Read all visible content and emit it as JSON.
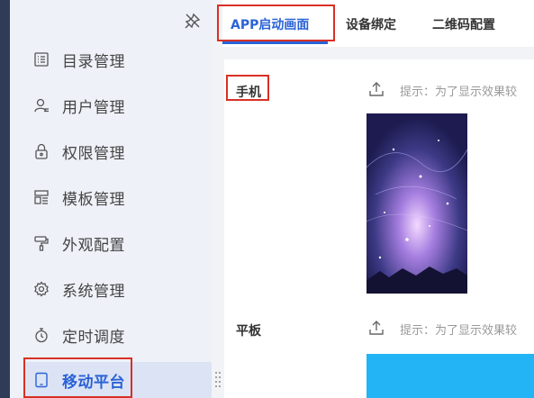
{
  "sidebar": {
    "pin_icon": "pin-icon",
    "items": [
      {
        "label": "目录管理",
        "icon": "catalog-icon"
      },
      {
        "label": "用户管理",
        "icon": "user-icon"
      },
      {
        "label": "权限管理",
        "icon": "lock-icon"
      },
      {
        "label": "模板管理",
        "icon": "template-icon"
      },
      {
        "label": "外观配置",
        "icon": "paint-roller-icon"
      },
      {
        "label": "系统管理",
        "icon": "gear-icon"
      },
      {
        "label": "定时调度",
        "icon": "stopwatch-icon"
      },
      {
        "label": "移动平台",
        "icon": "tablet-icon",
        "active": true
      }
    ]
  },
  "tabs": [
    {
      "label": "APP启动画面",
      "active": true
    },
    {
      "label": "设备绑定"
    },
    {
      "label": "二维码配置"
    }
  ],
  "content": {
    "phone": {
      "label": "手机",
      "hint": "提示：为了显示效果较"
    },
    "tablet": {
      "label": "平板",
      "hint": "提示：为了显示效果较"
    }
  },
  "colors": {
    "accent": "#2a62d6",
    "highlight_box": "#d93025",
    "sidebar_bg": "#eef1f8",
    "active_bg": "#dbe3f5",
    "tablet_preview": "#22b4f5"
  }
}
